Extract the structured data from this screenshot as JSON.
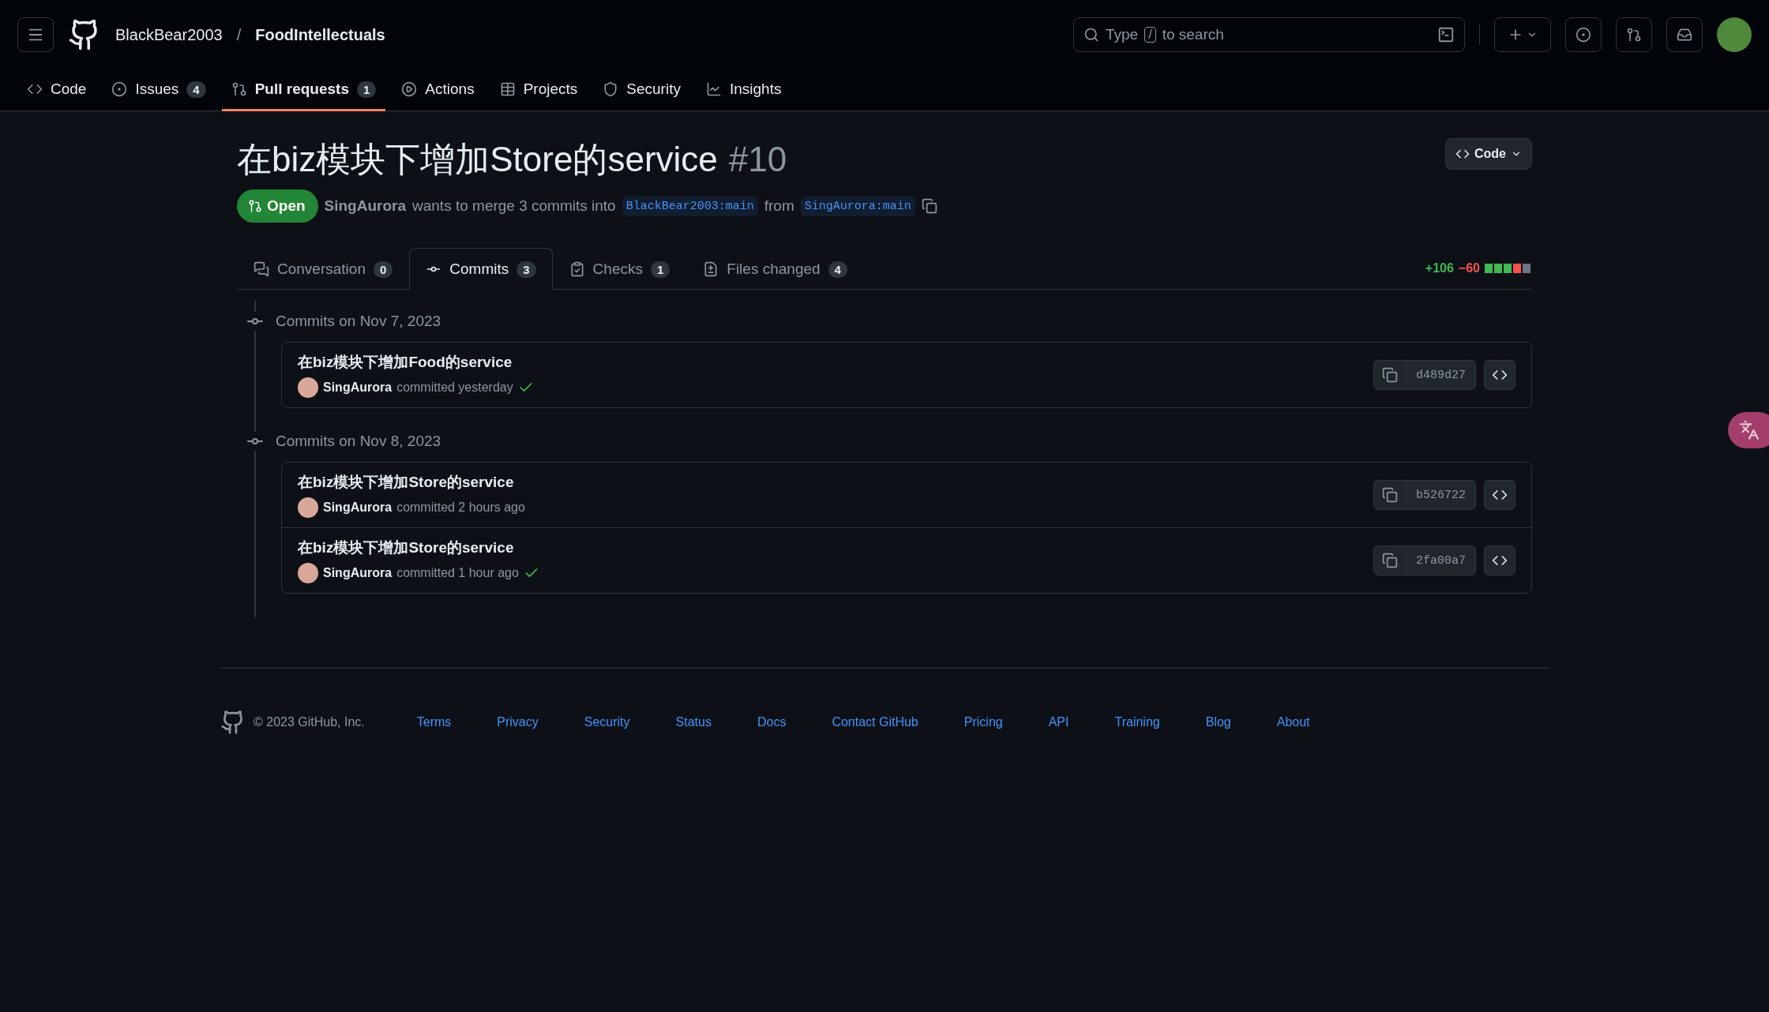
{
  "header": {
    "owner": "BlackBear2003",
    "separator": "/",
    "repo": "FoodIntellectuals",
    "search": {
      "placeholder_before": "Type",
      "key": "/",
      "placeholder_after": "to search"
    }
  },
  "repo_nav": [
    {
      "label": "Code",
      "selected": false
    },
    {
      "label": "Issues",
      "count": "4",
      "selected": false
    },
    {
      "label": "Pull requests",
      "count": "1",
      "selected": true
    },
    {
      "label": "Actions",
      "selected": false
    },
    {
      "label": "Projects",
      "selected": false
    },
    {
      "label": "Security",
      "selected": false
    },
    {
      "label": "Insights",
      "selected": false
    }
  ],
  "pr": {
    "title": "在biz模块下增加Store的service",
    "number": "#10",
    "code_button": "Code",
    "state": "Open",
    "author": "SingAurora",
    "merge_text": "wants to merge 3 commits into",
    "base": "BlackBear2003:main",
    "from_text": "from",
    "head": "SingAurora:main"
  },
  "pr_tabs": [
    {
      "label": "Conversation",
      "count": "0",
      "selected": false
    },
    {
      "label": "Commits",
      "count": "3",
      "selected": true
    },
    {
      "label": "Checks",
      "count": "1",
      "selected": false
    },
    {
      "label": "Files changed",
      "count": "4",
      "selected": false
    }
  ],
  "diffstat": {
    "additions": "+106",
    "deletions": "−60"
  },
  "commit_groups": [
    {
      "heading": "Commits on Nov 7, 2023",
      "commits": [
        {
          "message": "在biz模块下增加Food的service",
          "author": "SingAurora",
          "when": "committed yesterday",
          "verified": true,
          "sha": "d489d27"
        }
      ]
    },
    {
      "heading": "Commits on Nov 8, 2023",
      "commits": [
        {
          "message": "在biz模块下增加Store的service",
          "author": "SingAurora",
          "when": "committed 2 hours ago",
          "verified": false,
          "sha": "b526722"
        },
        {
          "message": "在biz模块下增加Store的service",
          "author": "SingAurora",
          "when": "committed 1 hour ago",
          "verified": true,
          "sha": "2fa00a7"
        }
      ]
    }
  ],
  "footer": {
    "copyright": "© 2023 GitHub, Inc.",
    "links": [
      "Terms",
      "Privacy",
      "Security",
      "Status",
      "Docs",
      "Contact GitHub",
      "Pricing",
      "API",
      "Training",
      "Blog",
      "About"
    ]
  }
}
